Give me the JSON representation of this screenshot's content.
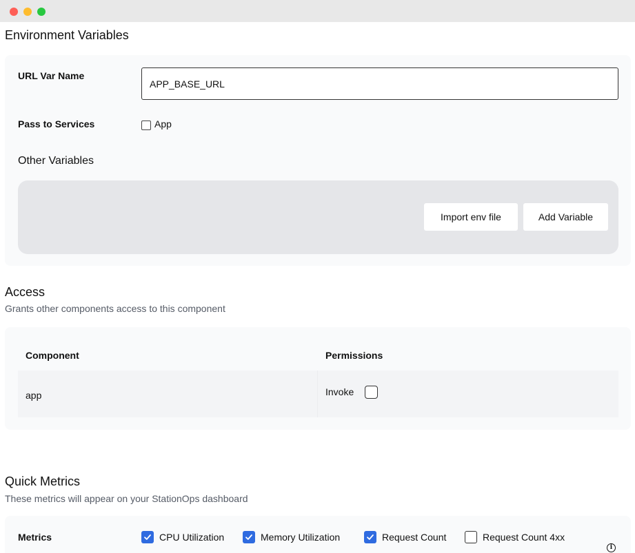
{
  "env": {
    "title": "Environment Variables",
    "url_var_label": "URL Var Name",
    "url_var_value": "APP_BASE_URL",
    "pass_label": "Pass to Services",
    "pass_option": "App",
    "other_title": "Other Variables",
    "import_button": "Import env file",
    "add_button": "Add Variable"
  },
  "access": {
    "title": "Access",
    "subtitle": "Grants other components access to this component",
    "col_component": "Component",
    "col_permissions": "Permissions",
    "rows": [
      {
        "component": "app",
        "permission": "Invoke"
      }
    ]
  },
  "metrics": {
    "title": "Quick Metrics",
    "subtitle": "These metrics will appear on your StationOps dashboard",
    "label": "Metrics",
    "options": [
      {
        "label": "CPU Utilization",
        "checked": true
      },
      {
        "label": "Memory Utilization",
        "checked": true
      },
      {
        "label": "Request Count",
        "checked": true
      },
      {
        "label": "Request Count 4xx",
        "checked": false
      }
    ]
  },
  "colors": {
    "accent": "#2f6be0",
    "panel": "#f9fafb",
    "vars_box": "#e5e6e9"
  }
}
